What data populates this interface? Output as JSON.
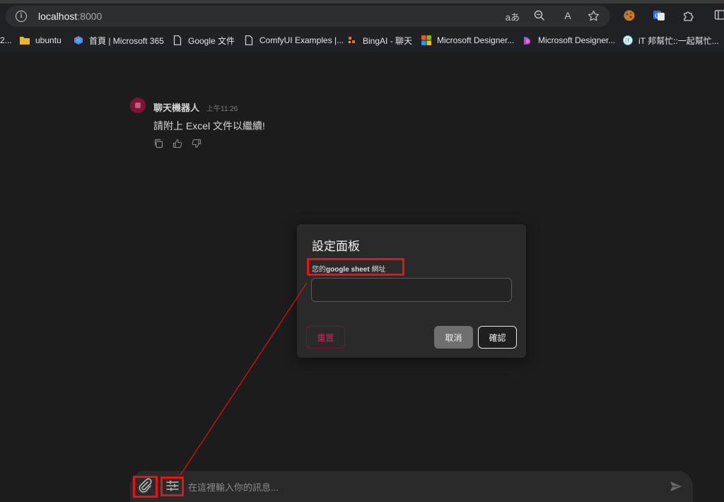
{
  "browser": {
    "url_host": "localhost",
    "url_port": ":8000",
    "read_aloud_label": "A",
    "translate_label": "aあ"
  },
  "bookmarks": [
    {
      "label": "2...",
      "icon": "truncated-icon"
    },
    {
      "label": "ubuntu",
      "icon": "folder-icon"
    },
    {
      "label": "首頁 | Microsoft 365",
      "icon": "microsoft365-icon"
    },
    {
      "label": "Google 文件",
      "icon": "page-icon"
    },
    {
      "label": "ComfyUI Examples |...",
      "icon": "page-icon"
    },
    {
      "label": "BingAI - 聊天",
      "icon": "bing-icon"
    },
    {
      "label": "Microsoft Designer...",
      "icon": "microsoft-icon"
    },
    {
      "label": "Microsoft Designer...",
      "icon": "designer-icon"
    },
    {
      "label": "iT 邦幫忙::一起幫忙...",
      "icon": "ithelp-icon"
    }
  ],
  "chat": {
    "bot_name": "聊天機器人",
    "timestamp": "上午11:26",
    "message": "請附上 Excel 文件以繼續!",
    "input_placeholder": "在這裡輸入你的訊息..."
  },
  "dialog": {
    "title": "設定面板",
    "label_prefix": "您的",
    "label_bold": "google sheet",
    "label_suffix": " 網址",
    "input_value": "",
    "reset_label": "重置",
    "cancel_label": "取消",
    "confirm_label": "確認"
  },
  "colors": {
    "accent": "#c0305e",
    "highlight": "#ee1111",
    "background": "#1c1c1c"
  }
}
